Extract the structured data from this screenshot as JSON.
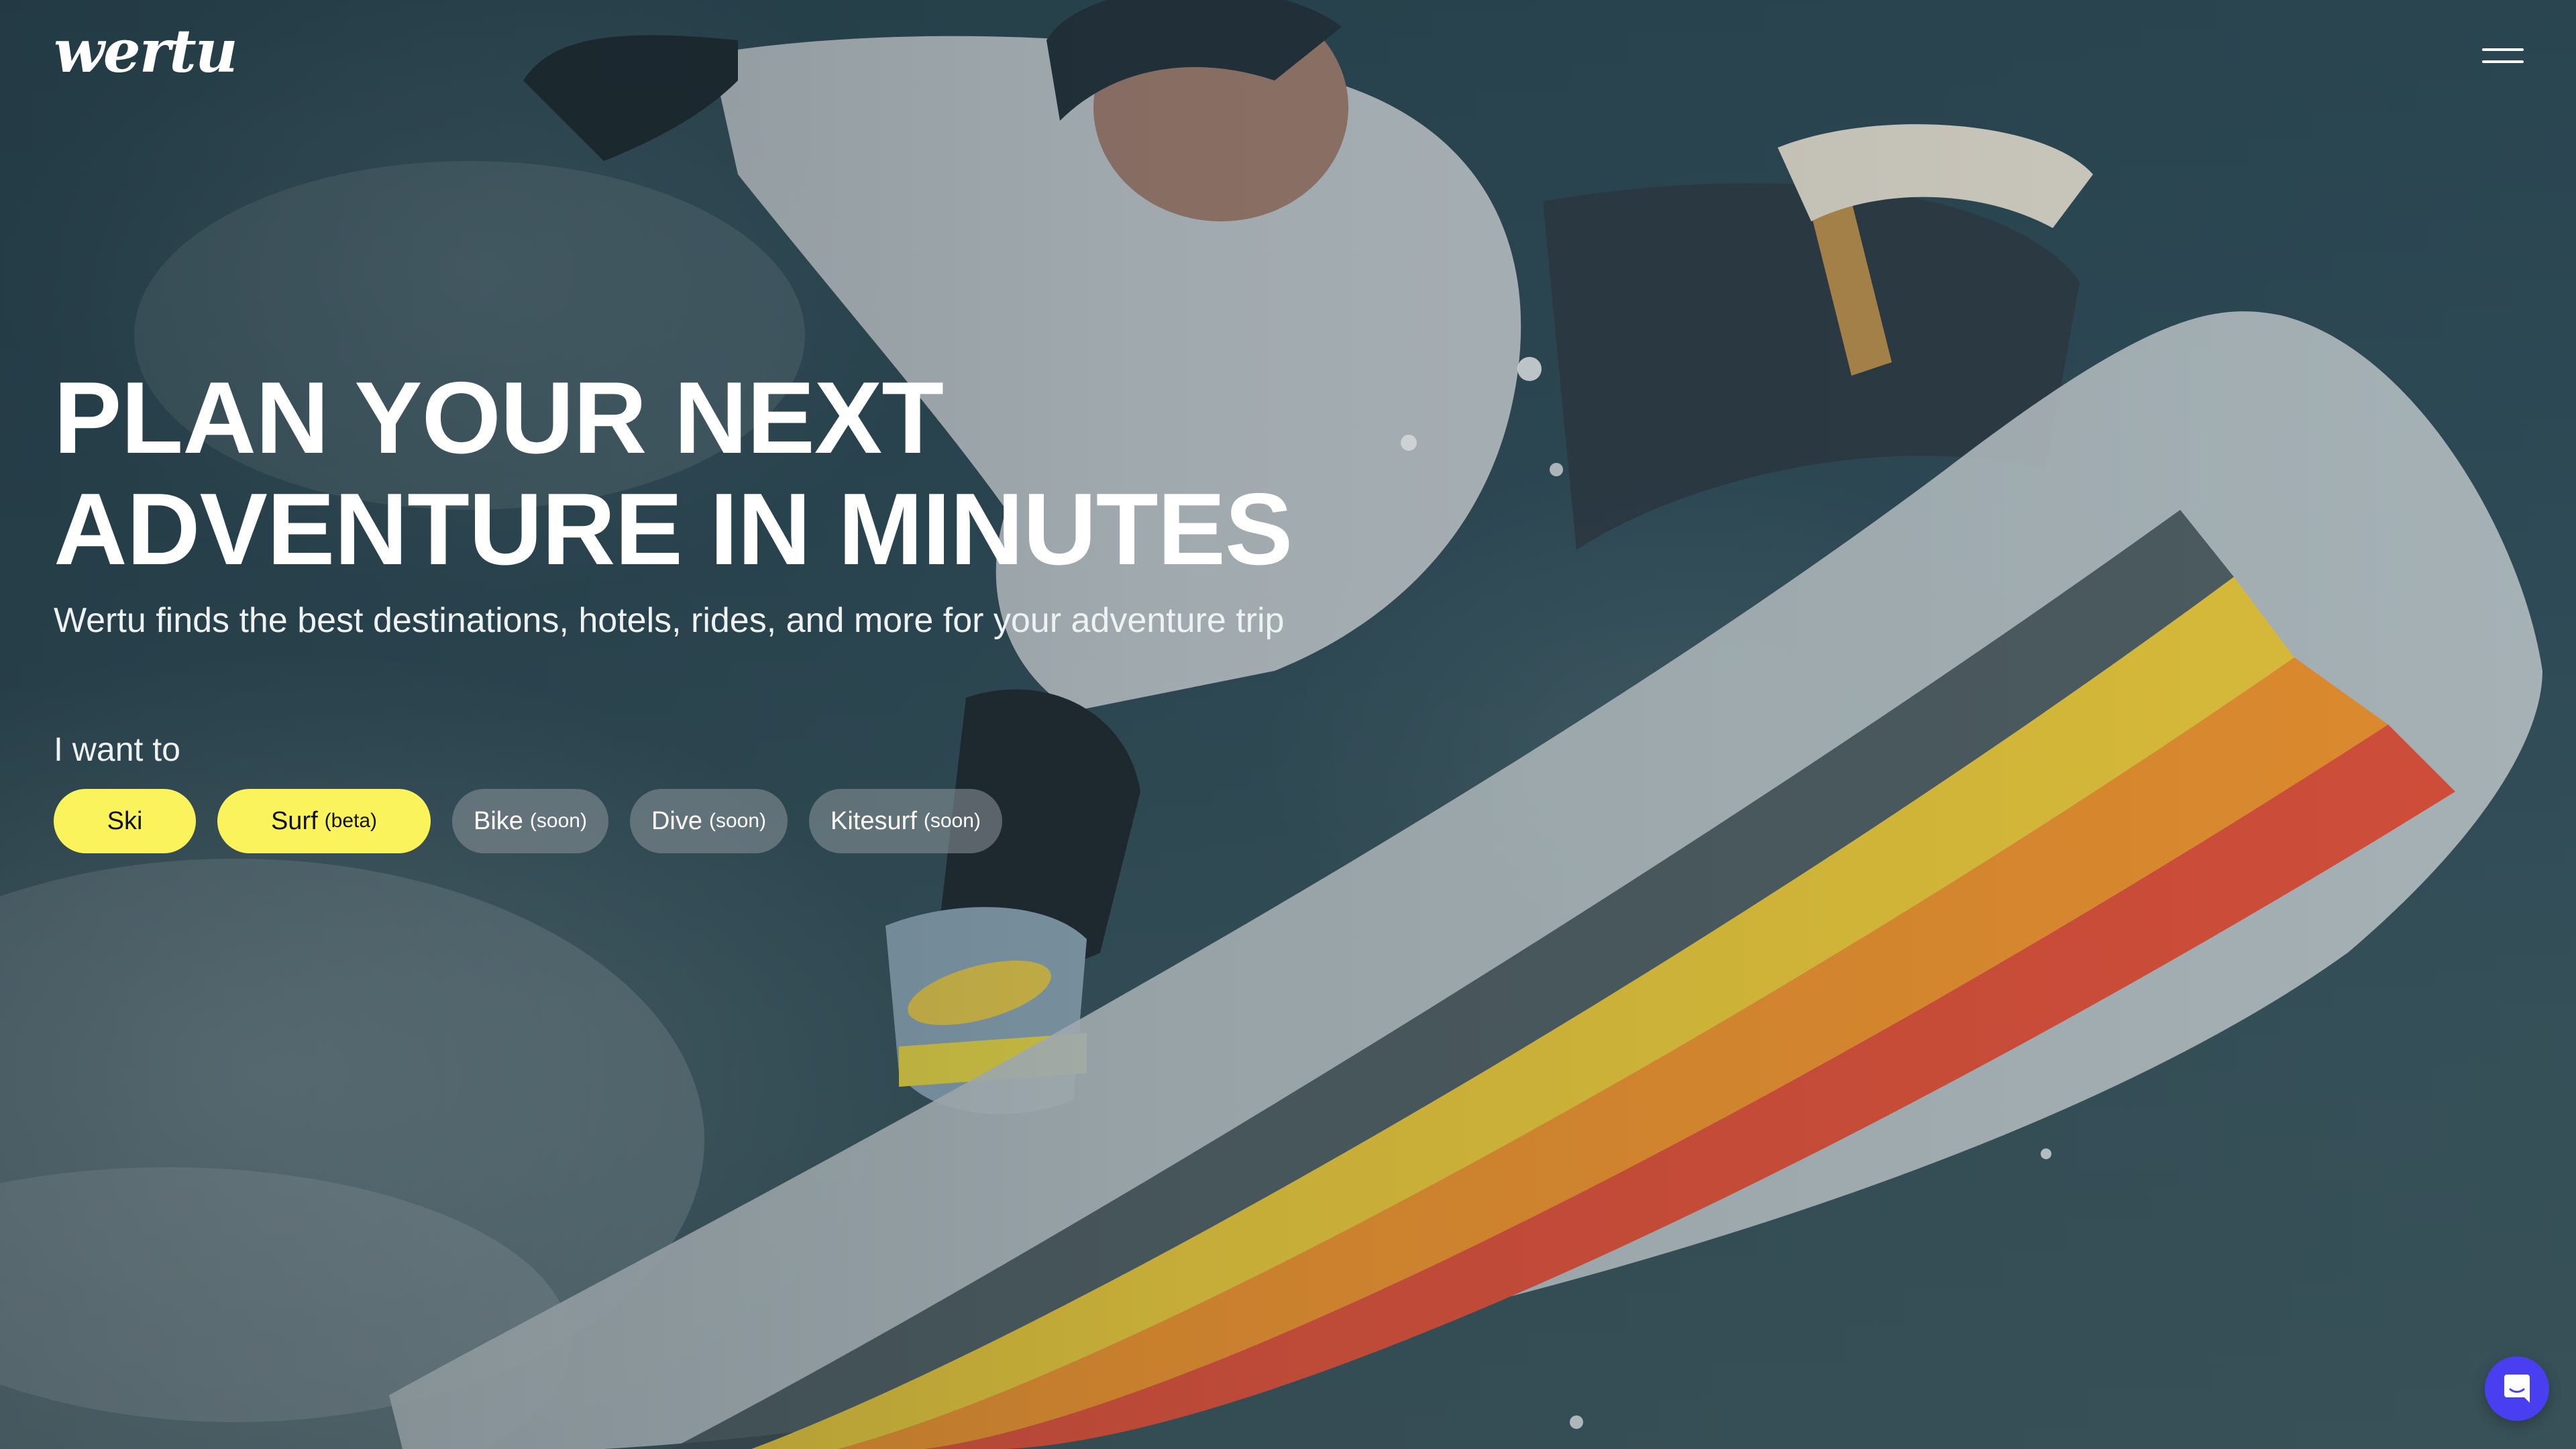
{
  "header": {
    "logo_text": "wertu",
    "menu_icon": "hamburger-menu-icon"
  },
  "hero": {
    "headline_line1": "PLAN YOUR NEXT",
    "headline_line2": "ADVENTURE IN MINUTES",
    "subtitle": "Wertu finds the best destinations, hotels, rides, and more for your adventure trip",
    "prompt": "I want to"
  },
  "activities": [
    {
      "label": "Ski",
      "tag": "",
      "state": "active"
    },
    {
      "label": "Surf",
      "tag": "(beta)",
      "state": "active"
    },
    {
      "label": "Bike",
      "tag": "(soon)",
      "state": "inactive"
    },
    {
      "label": "Dive",
      "tag": "(soon)",
      "state": "inactive"
    },
    {
      "label": "Kitesurf",
      "tag": "(soon)",
      "state": "inactive"
    }
  ],
  "chat": {
    "icon": "chat-bubble-icon"
  },
  "colors": {
    "accent_yellow": "#fbf35b",
    "chat_purple": "#4a3ff0",
    "inactive_pill": "#8c969b"
  }
}
